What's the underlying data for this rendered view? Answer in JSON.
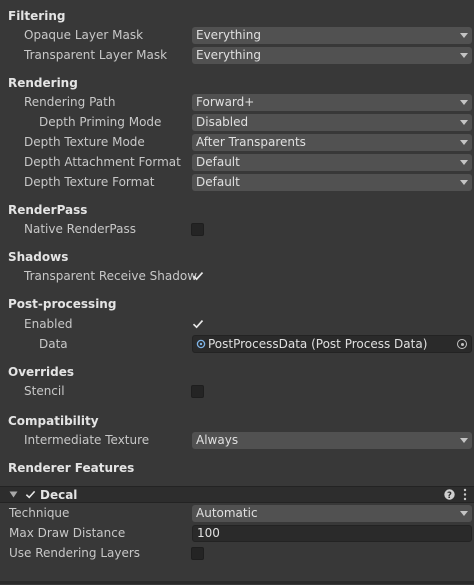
{
  "sections": {
    "filtering": "Filtering",
    "rendering": "Rendering",
    "renderpass": "RenderPass",
    "shadows": "Shadows",
    "postprocessing": "Post-processing",
    "overrides": "Overrides",
    "compatibility": "Compatibility",
    "renderer_features": "Renderer Features"
  },
  "filtering": {
    "opaque_label": "Opaque Layer Mask",
    "opaque_value": "Everything",
    "transparent_label": "Transparent Layer Mask",
    "transparent_value": "Everything"
  },
  "rendering": {
    "path_label": "Rendering Path",
    "path_value": "Forward+",
    "priming_label": "Depth Priming Mode",
    "priming_value": "Disabled",
    "depth_tex_mode_label": "Depth Texture Mode",
    "depth_tex_mode_value": "After Transparents",
    "depth_attach_label": "Depth Attachment Format",
    "depth_attach_value": "Default",
    "depth_tex_format_label": "Depth Texture Format",
    "depth_tex_format_value": "Default"
  },
  "renderpass": {
    "native_label": "Native RenderPass",
    "native_checked": false
  },
  "shadows": {
    "transparent_receive_label": "Transparent Receive Shadow",
    "transparent_receive_checked": true
  },
  "postprocessing": {
    "enabled_label": "Enabled",
    "enabled_checked": true,
    "data_label": "Data",
    "data_value": "PostProcessData (Post Process Data)"
  },
  "overrides": {
    "stencil_label": "Stencil",
    "stencil_checked": false
  },
  "compatibility": {
    "intermediate_label": "Intermediate Texture",
    "intermediate_value": "Always"
  },
  "decal": {
    "title": "Decal",
    "enabled": true,
    "technique_label": "Technique",
    "technique_value": "Automatic",
    "max_distance_label": "Max Draw Distance",
    "max_distance_value": "100",
    "rendering_layers_label": "Use Rendering Layers",
    "rendering_layers_checked": false
  },
  "icons": {
    "dropdown": "chevron-down-icon",
    "check": "checkmark-icon",
    "object": "scriptable-object-icon",
    "picker": "object-picker-icon",
    "help": "help-icon",
    "menu": "kebab-menu-icon",
    "foldout": "foldout-arrow-icon"
  }
}
